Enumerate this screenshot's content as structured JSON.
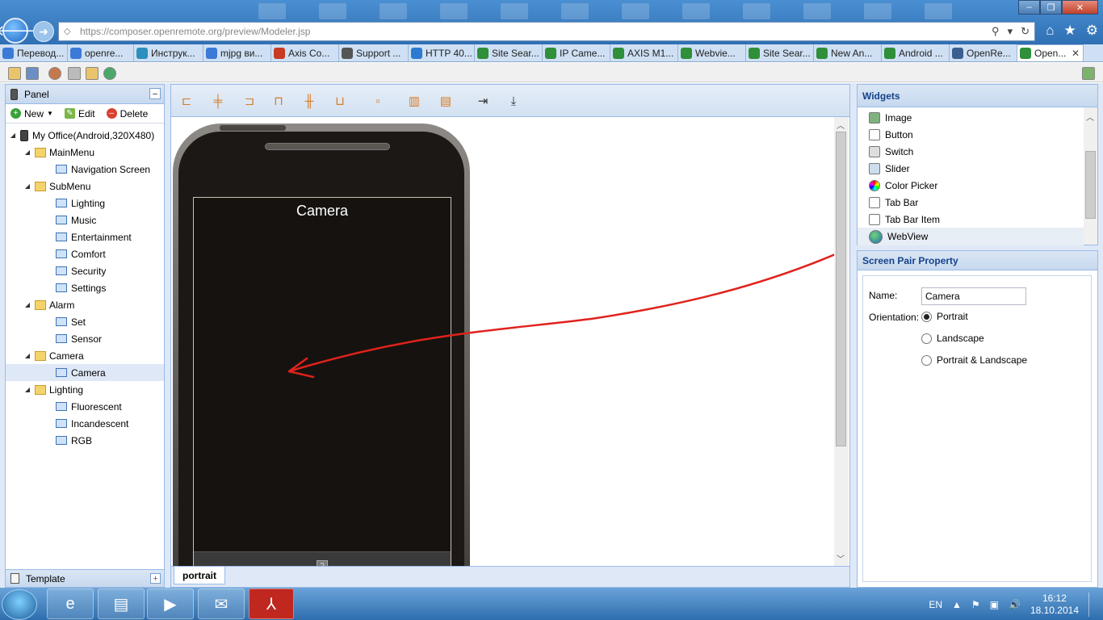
{
  "browser": {
    "url": "https://composer.openremote.org/preview/Modeler.jsp",
    "tabs": [
      {
        "label": "Перевод...",
        "icon": "translate-icon",
        "color": "#3b7ad6"
      },
      {
        "label": "openre...",
        "icon": "google-icon",
        "color": "#3b7ad6"
      },
      {
        "label": "Инструк...",
        "icon": "diamond-icon",
        "color": "#2c8fbd"
      },
      {
        "label": "mjpg ви...",
        "icon": "google-icon",
        "color": "#3b7ad6"
      },
      {
        "label": "Axis Co...",
        "icon": "axis-icon",
        "color": "#c83a22"
      },
      {
        "label": "Support ...",
        "icon": "support-icon",
        "color": "#555555"
      },
      {
        "label": "HTTP 40...",
        "icon": "ie-icon",
        "color": "#2b7bd0"
      },
      {
        "label": "Site Sear...",
        "icon": "android-icon",
        "color": "#2f8f3a"
      },
      {
        "label": "IP Came...",
        "icon": "android-icon",
        "color": "#2f8f3a"
      },
      {
        "label": "AXIS M1...",
        "icon": "android-icon",
        "color": "#2f8f3a"
      },
      {
        "label": "Webvie...",
        "icon": "android-icon",
        "color": "#2f8f3a"
      },
      {
        "label": "Site Sear...",
        "icon": "android-icon",
        "color": "#2f8f3a"
      },
      {
        "label": "New An...",
        "icon": "android-icon",
        "color": "#2f8f3a"
      },
      {
        "label": "Android ...",
        "icon": "android-icon",
        "color": "#2f8f3a"
      },
      {
        "label": "OpenRe...",
        "icon": "sf-icon",
        "color": "#3a5f8f"
      },
      {
        "label": "Open...",
        "icon": "android-icon",
        "color": "#2f8f3a",
        "active": true
      }
    ]
  },
  "left_panel": {
    "title": "Panel",
    "actions": {
      "new": "New",
      "edit": "Edit",
      "delete": "Delete"
    },
    "tree": [
      {
        "label": "My Office(Android,320X480)",
        "type": "device",
        "level": 0
      },
      {
        "label": "MainMenu",
        "type": "group",
        "level": 1
      },
      {
        "label": "Navigation Screen",
        "type": "screen",
        "level": 2
      },
      {
        "label": "SubMenu",
        "type": "group",
        "level": 1
      },
      {
        "label": "Lighting",
        "type": "screen",
        "level": 2
      },
      {
        "label": "Music",
        "type": "screen",
        "level": 2
      },
      {
        "label": "Entertainment",
        "type": "screen",
        "level": 2
      },
      {
        "label": "Comfort",
        "type": "screen",
        "level": 2
      },
      {
        "label": "Security",
        "type": "screen",
        "level": 2
      },
      {
        "label": "Settings",
        "type": "screen",
        "level": 2
      },
      {
        "label": "Alarm",
        "type": "group",
        "level": 1
      },
      {
        "label": "Set",
        "type": "screen",
        "level": 2
      },
      {
        "label": "Sensor",
        "type": "screen",
        "level": 2
      },
      {
        "label": "Camera",
        "type": "group",
        "level": 1
      },
      {
        "label": "Camera",
        "type": "screen",
        "level": 2,
        "selected": true
      },
      {
        "label": "Lighting",
        "type": "group",
        "level": 1
      },
      {
        "label": "Fluorescent",
        "type": "screen",
        "level": 2
      },
      {
        "label": "Incandescent",
        "type": "screen",
        "level": 2
      },
      {
        "label": "RGB",
        "type": "screen",
        "level": 2
      }
    ],
    "footer": "Template"
  },
  "canvas": {
    "screen_title": "Camera",
    "tab": "portrait",
    "annotation_color": "#e0221c"
  },
  "widgets": {
    "title": "Widgets",
    "items": [
      {
        "label": "Image",
        "icon": "image-icon"
      },
      {
        "label": "Button",
        "icon": "button-icon"
      },
      {
        "label": "Switch",
        "icon": "switch-icon"
      },
      {
        "label": "Slider",
        "icon": "slider-icon"
      },
      {
        "label": "Color Picker",
        "icon": "color-picker-icon"
      },
      {
        "label": "Tab Bar",
        "icon": "tab-bar-icon"
      },
      {
        "label": "Tab Bar Item",
        "icon": "tab-bar-item-icon"
      },
      {
        "label": "WebView",
        "icon": "globe-icon"
      }
    ]
  },
  "screen_pair_property": {
    "title": "Screen Pair Property",
    "name_label": "Name:",
    "name_value": "Camera",
    "orientation_label": "Orientation:",
    "options": [
      {
        "label": "Portrait",
        "checked": true
      },
      {
        "label": "Landscape",
        "checked": false
      },
      {
        "label": "Portrait & Landscape",
        "checked": false
      }
    ]
  },
  "taskbar": {
    "language": "EN",
    "time": "16:12",
    "date": "18.10.2014"
  }
}
